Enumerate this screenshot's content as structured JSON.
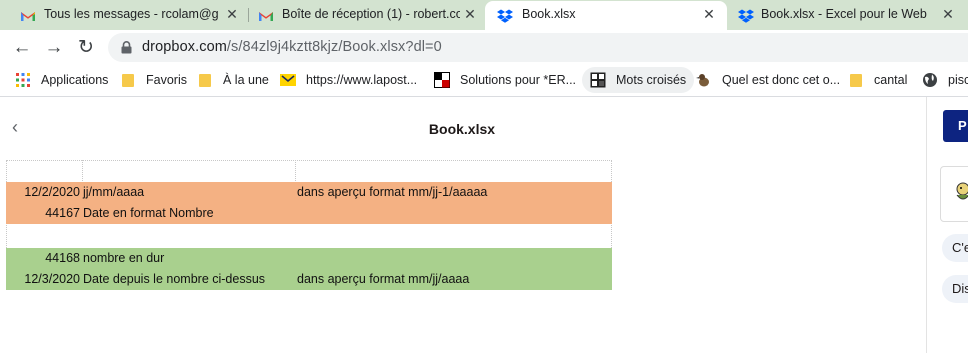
{
  "tabs": [
    {
      "title": "Tous les messages - rcolam@gm",
      "icon": "gmail-icon",
      "active": false
    },
    {
      "title": "Boîte de réception (1) - robert.co",
      "icon": "gmail-icon",
      "active": false
    },
    {
      "title": "Book.xlsx",
      "icon": "dropbox-icon",
      "active": true
    },
    {
      "title": "Book.xlsx - Excel pour le Web",
      "icon": "dropbox-icon",
      "active": false
    }
  ],
  "omnibox": {
    "url_host": "dropbox.com",
    "url_path": "/s/84zl9j4kztt8kjz/Book.xlsx?dl=0"
  },
  "bookmarks": [
    {
      "label": "Applications",
      "icon": "apps-grid-icon"
    },
    {
      "label": "Favoris",
      "icon": "folder-icon"
    },
    {
      "label": "À la une",
      "icon": "folder-icon"
    },
    {
      "label": "https://www.lapost...",
      "icon": "laposte-icon"
    },
    {
      "label": "Solutions pour *ER...",
      "icon": "crossword-icon"
    },
    {
      "label": "Mots croisés",
      "icon": "crossword-grid-icon"
    },
    {
      "label": "Quel est donc cet o...",
      "icon": "bird-icon"
    },
    {
      "label": "cantal",
      "icon": "folder-icon"
    },
    {
      "label": "pisci",
      "icon": "globe-icon"
    }
  ],
  "page": {
    "title": "Book.xlsx",
    "sidebar_button": "P",
    "sidebar_pills": [
      "C'e",
      "Dis"
    ]
  },
  "sheet": {
    "rows": [
      {
        "a": "",
        "b": "",
        "c": "",
        "fill": "none"
      },
      {
        "a": "12/2/2020",
        "b": "jj/mm/aaaa",
        "c": "dans aperçu format mm/jj-1/aaaaa",
        "fill": "orange"
      },
      {
        "a": "44167",
        "b": "Date en format Nombre",
        "c": "",
        "fill": "orange"
      },
      {
        "a": "",
        "b": "",
        "c": "",
        "fill": "none"
      },
      {
        "a": "44168",
        "b": "nombre en dur",
        "c": "",
        "fill": "green"
      },
      {
        "a": "12/3/2020",
        "b": "Date depuis le nombre ci-dessus",
        "c": "dans aperçu format mm/jj/aaaa",
        "fill": "green"
      }
    ]
  },
  "colors": {
    "tab_strip": "#d3e3d0",
    "orange_fill": "#f4b183",
    "green_fill": "#a9d08e",
    "dropbox_blue": "#0061fe",
    "sidebar_button": "#0d2481"
  }
}
